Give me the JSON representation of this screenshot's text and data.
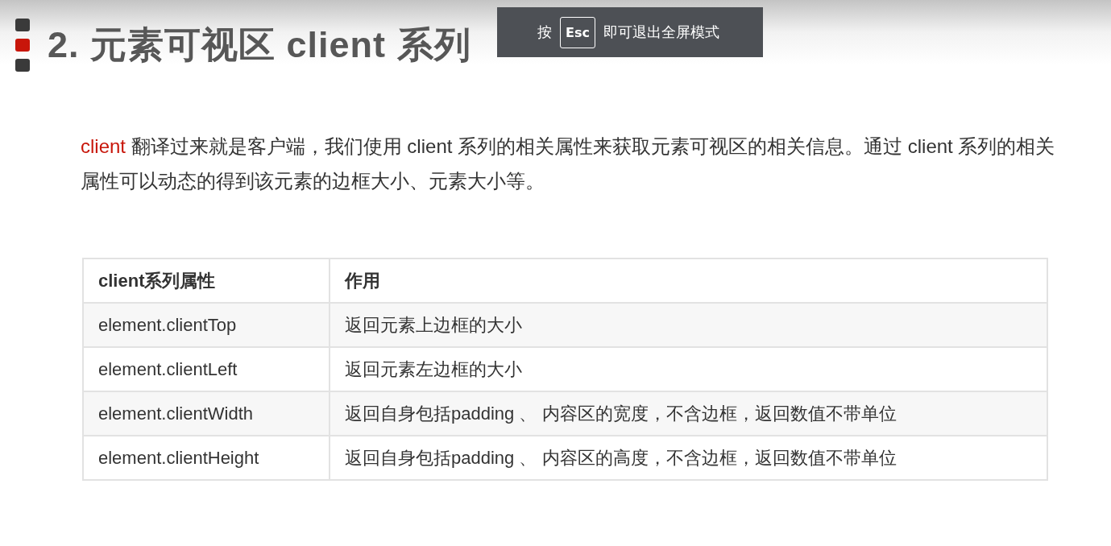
{
  "slide": {
    "title": "2. 元素可视区 client 系列",
    "intro": {
      "keyword": "client",
      "text": " 翻译过来就是客户端，我们使用 client 系列的相关属性来获取元素可视区的相关信息。通过 client 系列的相关属性可以动态的得到该元素的边框大小、元素大小等。"
    },
    "table": {
      "columns": [
        "client系列属性",
        "作用"
      ],
      "rows": [
        [
          "element.clientTop",
          "返回元素上边框的大小"
        ],
        [
          "element.clientLeft",
          "返回元素左边框的大小"
        ],
        [
          "element.clientWidth",
          "返回自身包括padding 、 内容区的宽度，不含边框，返回数值不带单位"
        ],
        [
          "element.clientHeight",
          "返回自身包括padding 、 内容区的高度，不含边框，返回数值不带单位"
        ]
      ]
    }
  },
  "fullscreen_notice": {
    "prefix": "按",
    "key": "Esc",
    "suffix": "即可退出全屏模式"
  }
}
